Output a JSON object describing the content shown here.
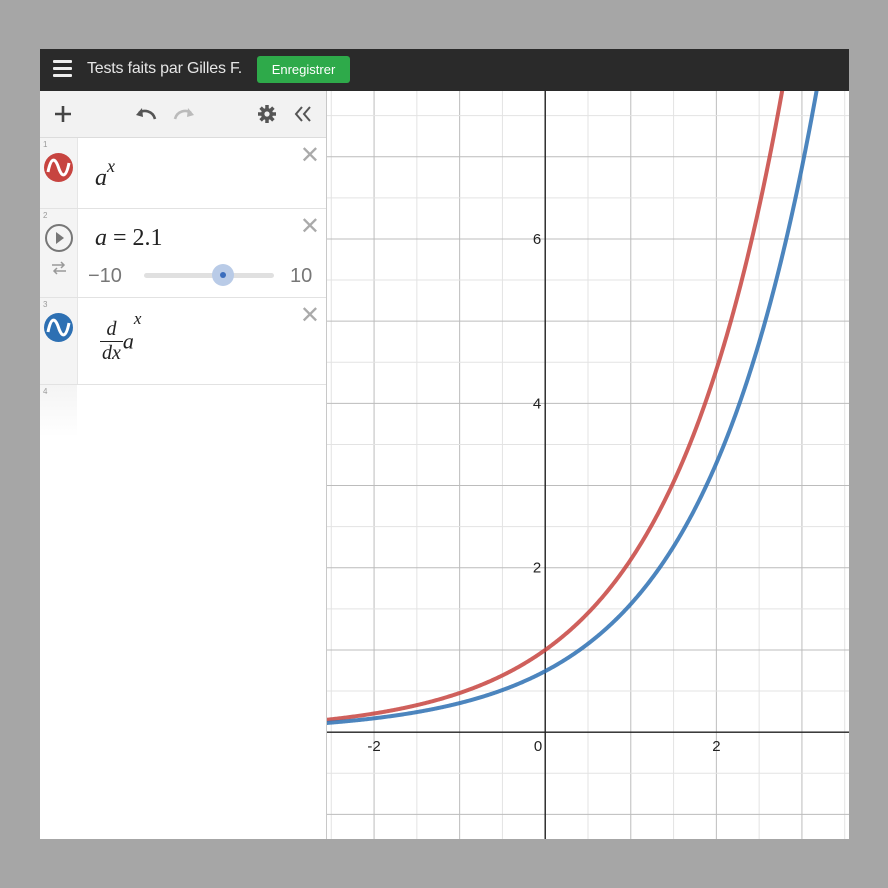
{
  "topbar": {
    "title": "Tests faits par Gilles F.",
    "save_label": "Enregistrer",
    "save_color": "#2eaa4a"
  },
  "toolbar": {
    "add_icon": "plus-icon",
    "undo_icon": "undo-icon",
    "redo_icon": "redo-icon",
    "settings_icon": "gear-icon",
    "collapse_icon": "double-chevron-left-icon"
  },
  "expressions": [
    {
      "index": "1",
      "base": "a",
      "exponent": "x",
      "color": "#c74440",
      "icon": "graph-wave-icon"
    },
    {
      "index": "2",
      "variable": "a",
      "equals": "=",
      "value": "2.1",
      "slider_min": "−10",
      "slider_max": "10",
      "play_icon": "play-icon",
      "loop_icon": "loop-icon",
      "slider_fraction": 0.605
    },
    {
      "index": "3",
      "deriv_num": "d",
      "deriv_den": "dx",
      "base": "a",
      "exponent": "x",
      "color": "#2d70b3",
      "icon": "graph-wave-icon"
    },
    {
      "index": "4"
    }
  ],
  "chart_data": {
    "type": "line",
    "title": "",
    "xlabel": "",
    "ylabel": "",
    "xlim": [
      -2.55,
      3.55
    ],
    "ylim": [
      -1.3,
      7.8
    ],
    "x_ticks": [
      "-2",
      "0",
      "2"
    ],
    "y_ticks": [
      "2",
      "4",
      "6"
    ],
    "grid": true,
    "parameter_a": 2.1,
    "series": [
      {
        "expression": "a^x",
        "color": "#c74440",
        "x": [
          -2.5,
          -2,
          -1.5,
          -1,
          -0.5,
          0,
          0.5,
          1,
          1.5,
          2,
          2.5,
          2.7
        ],
        "y": [
          0.16,
          0.23,
          0.33,
          0.48,
          0.69,
          1.0,
          1.45,
          2.1,
          3.04,
          4.41,
          6.39,
          7.41
        ]
      },
      {
        "expression": "d/dx a^x",
        "color": "#2d70b3",
        "x": [
          -2.5,
          -2,
          -1.5,
          -1,
          -0.5,
          0,
          0.5,
          1,
          1.5,
          2,
          2.5,
          3,
          3.1
        ],
        "y": [
          0.12,
          0.17,
          0.24,
          0.35,
          0.51,
          0.74,
          1.08,
          1.56,
          2.26,
          3.27,
          4.74,
          6.87,
          7.43
        ]
      }
    ]
  }
}
